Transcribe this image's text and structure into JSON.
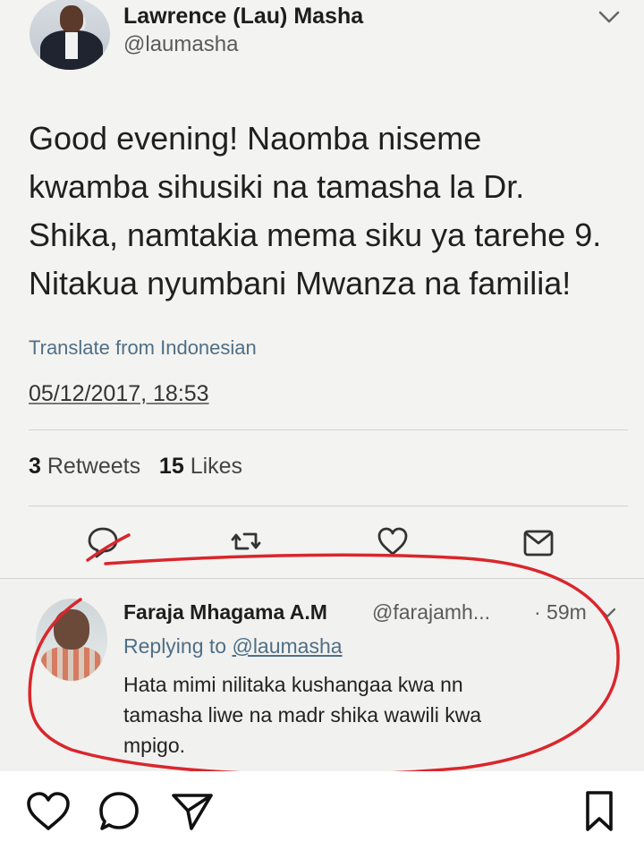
{
  "tweet": {
    "author_name": "Lawrence (Lau) Masha",
    "author_handle": "@laumasha",
    "text_lines": [
      "Good evening! Naomba niseme",
      "kwamba sihusiki na tamasha la Dr.",
      "Shika, namtakia mema siku ya tarehe 9.",
      "Nitakua nyumbani Mwanza na familia!"
    ],
    "translate_label": "Translate from Indonesian",
    "timestamp": "05/12/2017, 18:53",
    "retweets_count": "3",
    "retweets_label": "Retweets",
    "likes_count": "15",
    "likes_label": "Likes",
    "actions": [
      "reply-icon",
      "retweet-icon",
      "like-icon",
      "share-icon"
    ]
  },
  "reply": {
    "author_name": "Faraja Mhagama A.M",
    "author_handle": "@farajamh...",
    "time": "· 59m",
    "replying_prefix": "Replying to",
    "replying_mention": "@laumasha",
    "text_lines": [
      "Hata mimi nilitaka kushangaa kwa nn",
      "tamasha liwe na madr shika wawili kwa",
      "mpigo."
    ]
  },
  "instagram_bar": {
    "icons": [
      "heart-icon",
      "comment-icon",
      "send-icon",
      "bookmark-icon"
    ]
  },
  "colors": {
    "annotation_red": "#d9262c",
    "link_blue": "#4f6f86"
  }
}
